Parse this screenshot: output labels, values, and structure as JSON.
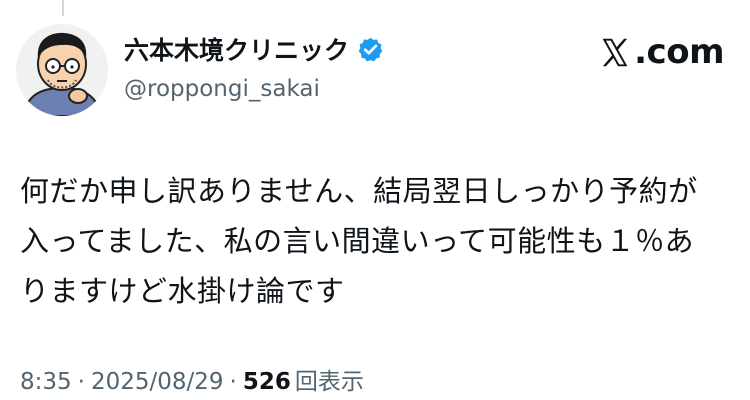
{
  "author": {
    "display_name": "六本木境クリニック",
    "handle": "@roppongi_sakai",
    "avatar_icon": "avatar-illustration",
    "verified_icon": "verified-badge-icon",
    "verified_color": "#1d9bf0"
  },
  "brand": {
    "logo_icon": "x-logo-icon",
    "text": ".com"
  },
  "tweet": {
    "text": "何だか申し訳ありません、結局翌日しっかり予約が入ってました、私の言い間違いって可能性も１％ありますけど水掛け論です"
  },
  "meta": {
    "time": "8:35",
    "separator": "·",
    "date": "2025/08/29",
    "views_count": "526",
    "views_label": "回表示"
  },
  "colors": {
    "text": "#0f1419",
    "secondary": "#536471",
    "background": "#ffffff"
  }
}
